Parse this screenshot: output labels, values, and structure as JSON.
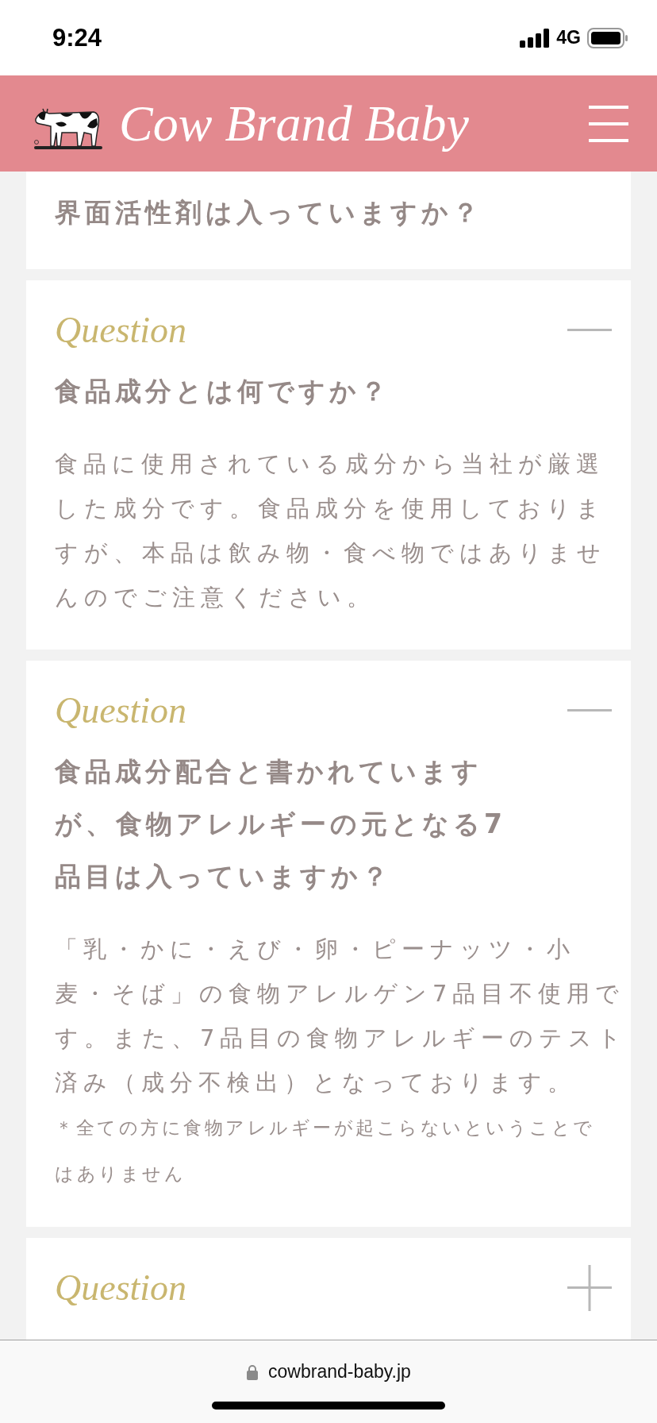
{
  "status_bar": {
    "time": "9:24",
    "network": "4G"
  },
  "header": {
    "logo_text": "Cow Brand Baby"
  },
  "faqs": [
    {
      "question": "界面活性剤は入っていますか？"
    },
    {
      "question_label": "Question",
      "expanded": true,
      "question": "食品成分とは何ですか？",
      "answer": "食品に使用されている成分から当社が厳選した成分です。食品成分を使用しておりますが、本品は飲み物・食べ物ではありませんのでご注意ください。"
    },
    {
      "question_label": "Question",
      "expanded": true,
      "question": "食品成分配合と書かれていますが、食物アレルギーの元となる7品目は入っていますか？",
      "answer": "「乳・かに・えび・卵・ピーナッツ・小麦・そば」の食物アレルゲン7品目不使用です。また、7品目の食物アレルギーのテスト済み（成分不検出）となっております。",
      "note": "＊全ての方に食物アレルギーが起こらないということではありません"
    },
    {
      "question_label": "Question",
      "expanded": false
    }
  ],
  "browser_bar": {
    "url": "cowbrand-baby.jp"
  }
}
